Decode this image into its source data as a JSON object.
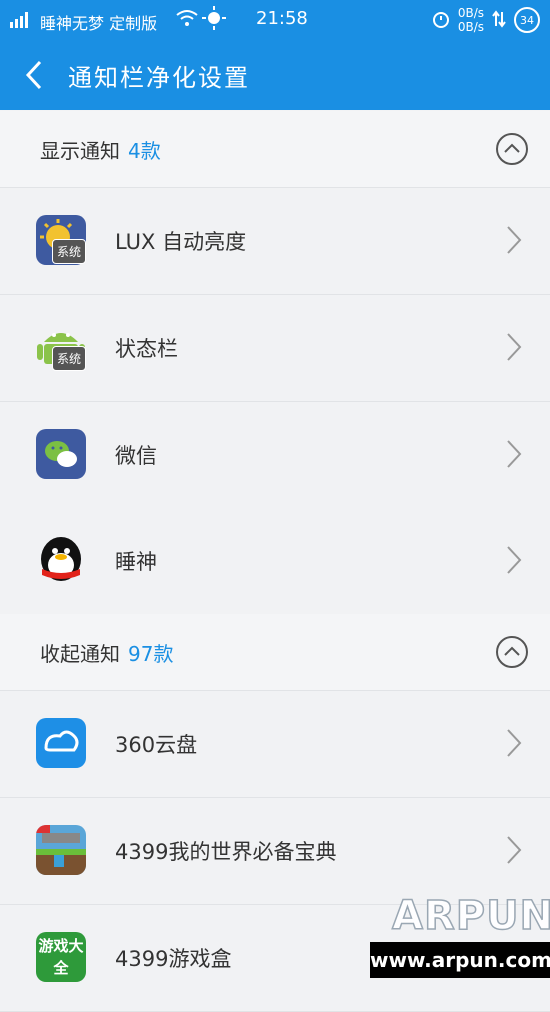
{
  "status_bar": {
    "carrier": "睡神无梦 定制版",
    "time": "21:58",
    "net_up": "0B/s",
    "net_down": "0B/s",
    "battery": "34"
  },
  "header": {
    "title": "通知栏净化设置"
  },
  "sections": [
    {
      "label": "显示通知",
      "count": "4款"
    },
    {
      "label": "收起通知",
      "count": "97款"
    }
  ],
  "apps": [
    {
      "name": "LUX 自动亮度",
      "badge": "系统",
      "icon": "lux-brightness-icon"
    },
    {
      "name": "状态栏",
      "badge": "系统",
      "icon": "android-icon"
    },
    {
      "name": "微信",
      "icon": "wechat-icon"
    },
    {
      "name": "睡神",
      "icon": "qq-penguin-icon"
    },
    {
      "name": "360云盘",
      "icon": "cloud-drive-icon"
    },
    {
      "name": "4399我的世界必备宝典",
      "icon": "minecraft-guide-icon"
    },
    {
      "name": "4399游戏盒",
      "icon": "game-box-icon",
      "icon_text": "游戏大全"
    }
  ],
  "watermark": {
    "brand": "ARPUN",
    "url": "www.arpun.com"
  },
  "colors": {
    "accent": "#1a8fe3",
    "background": "#f2f3f5"
  }
}
